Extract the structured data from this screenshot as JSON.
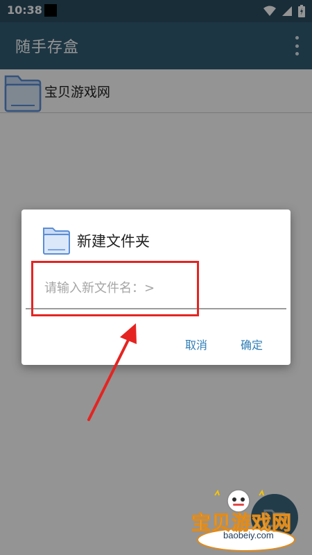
{
  "status_bar": {
    "time": "10:38"
  },
  "app_bar": {
    "title": "随手存盒",
    "overflow_icon": "more-vert-icon"
  },
  "folders": [
    {
      "name": "宝贝游戏网",
      "icon": "folder-icon"
    }
  ],
  "dialog": {
    "title": "新建文件夹",
    "input_placeholder": "请输入新文件名：>",
    "input_value": "",
    "cancel_label": "取消",
    "confirm_label": "确定"
  },
  "watermark": {
    "text": "宝贝游戏网",
    "url": "baobeiy.com"
  },
  "colors": {
    "status_bar": "#2c4e62",
    "app_bar": "#335e75",
    "button_text": "#2f7db6",
    "annotation_red": "#e52421",
    "folder_blue": "#5b8dd6"
  }
}
